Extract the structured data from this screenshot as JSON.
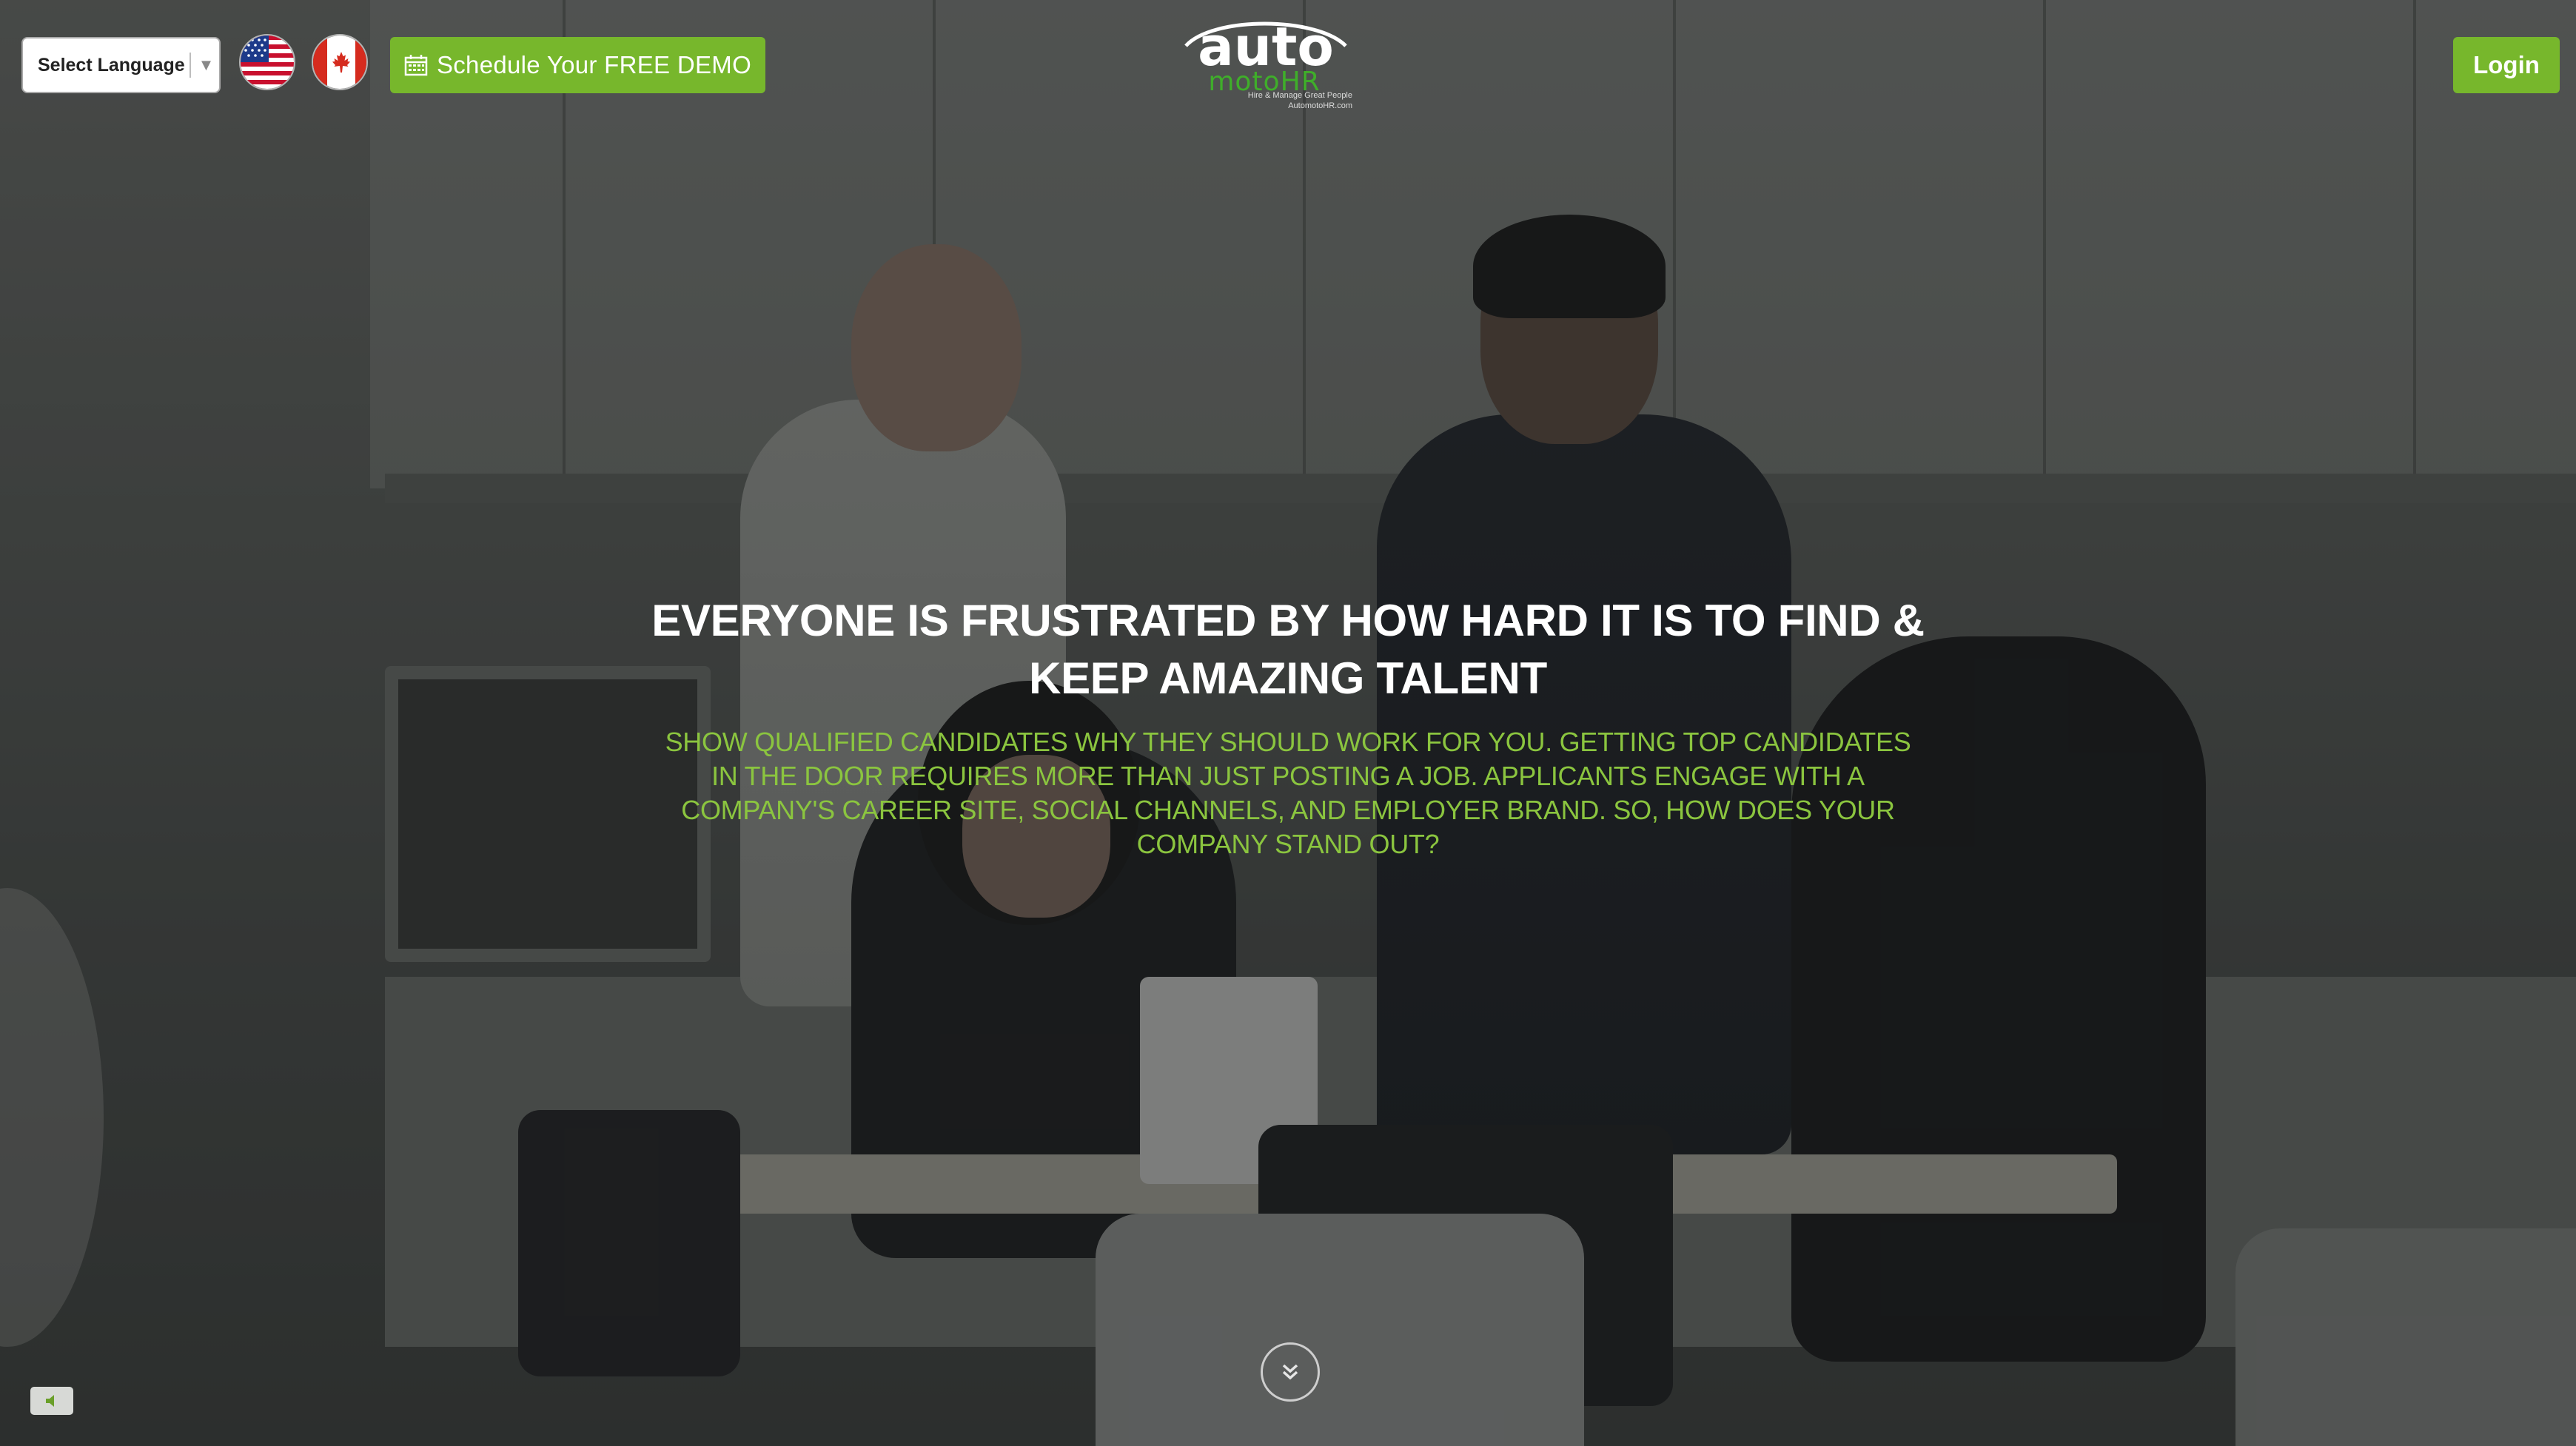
{
  "header": {
    "language_select_label": "Select Language",
    "language_select_arrow": "▼",
    "flags": [
      "us-flag-icon",
      "canada-flag-icon"
    ],
    "demo_button_label": "Schedule Your FREE DEMO",
    "login_label": "Login"
  },
  "logo": {
    "word_top": "auto",
    "word_bottom": "motoHR",
    "tagline_1": "Hire & Manage Great People",
    "tagline_2": "AutomotoHR.com"
  },
  "hero": {
    "title": "EVERYONE IS FRUSTRATED BY HOW HARD IT IS TO FIND & KEEP AMAZING TALENT",
    "subtitle": "SHOW QUALIFIED CANDIDATES WHY THEY SHOULD WORK FOR YOU. GETTING TOP CANDIDATES IN THE DOOR REQUIRES MORE THAN JUST POSTING A JOB. APPLICANTS ENGAGE WITH A COMPANY'S CAREER SITE, SOCIAL CHANNELS, AND EMPLOYER BRAND. SO, HOW DOES YOUR COMPANY STAND OUT?"
  },
  "controls": {
    "scroll_icon": "double-chevron-down-icon",
    "sound_icon": "speaker-icon"
  },
  "colors": {
    "accent_green": "#77b72c",
    "subtitle_green": "#8bc53f",
    "logo_green": "#3fae2a"
  }
}
